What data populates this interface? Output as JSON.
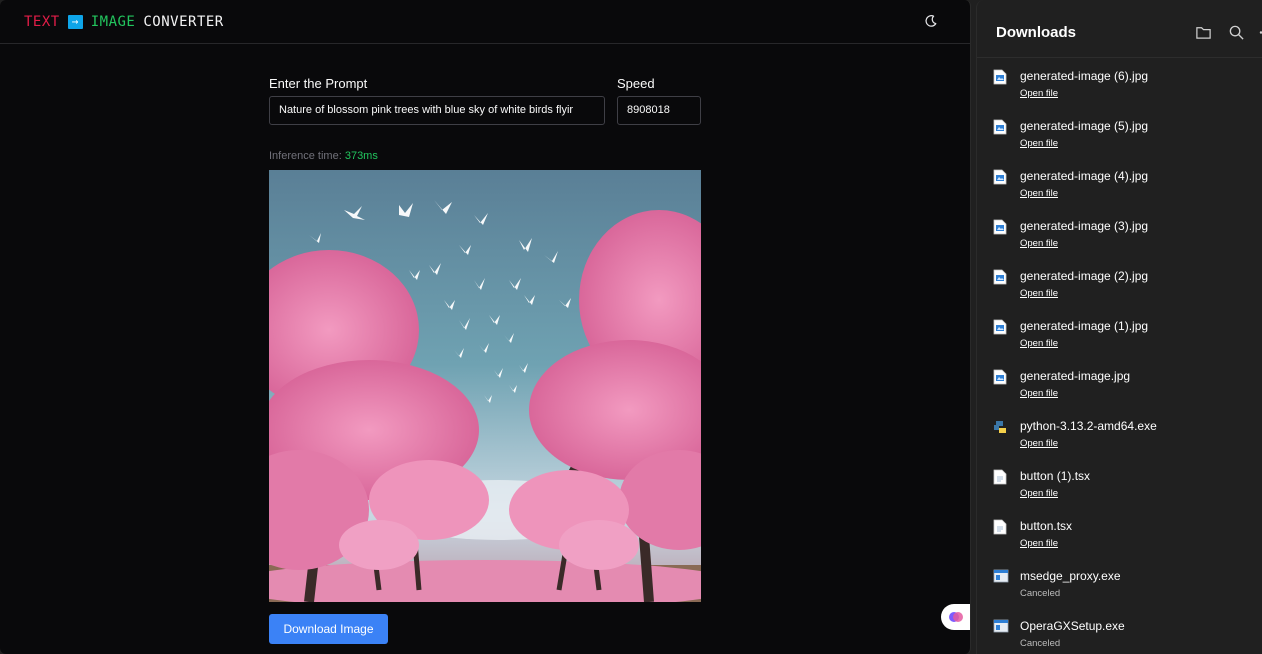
{
  "app": {
    "logo": {
      "part1": "TEXT",
      "arrow": "→",
      "part2": "IMAGE",
      "part3": "CONVERTER"
    },
    "prompt_label": "Enter the Prompt",
    "prompt_value": "Nature of blossom pink trees with blue sky of white birds flyir",
    "speed_label": "Speed",
    "speed_value": "8908018",
    "inference_label": "Inference time:",
    "inference_value": "373ms",
    "download_button": "Download Image",
    "theme_icon": "moon-icon"
  },
  "downloads": {
    "title": "Downloads",
    "icons": [
      "folder-icon",
      "search-icon",
      "more-icon"
    ],
    "items": [
      {
        "name": "generated-image (6).jpg",
        "action": "Open file",
        "type": "image"
      },
      {
        "name": "generated-image (5).jpg",
        "action": "Open file",
        "type": "image"
      },
      {
        "name": "generated-image (4).jpg",
        "action": "Open file",
        "type": "image"
      },
      {
        "name": "generated-image (3).jpg",
        "action": "Open file",
        "type": "image"
      },
      {
        "name": "generated-image (2).jpg",
        "action": "Open file",
        "type": "image"
      },
      {
        "name": "generated-image (1).jpg",
        "action": "Open file",
        "type": "image"
      },
      {
        "name": "generated-image.jpg",
        "action": "Open file",
        "type": "image"
      },
      {
        "name": "python-3.13.2-amd64.exe",
        "action": "Open file",
        "type": "python"
      },
      {
        "name": "button (1).tsx",
        "action": "Open file",
        "type": "doc"
      },
      {
        "name": "button.tsx",
        "action": "Open file",
        "type": "doc"
      },
      {
        "name": "msedge_proxy.exe",
        "status": "Canceled",
        "type": "exe"
      },
      {
        "name": "OperaGXSetup.exe",
        "status": "Canceled",
        "type": "exe"
      }
    ]
  },
  "colors": {
    "accent": "#3b82f6",
    "success": "#22c55e",
    "logo_red": "#e11d48"
  }
}
